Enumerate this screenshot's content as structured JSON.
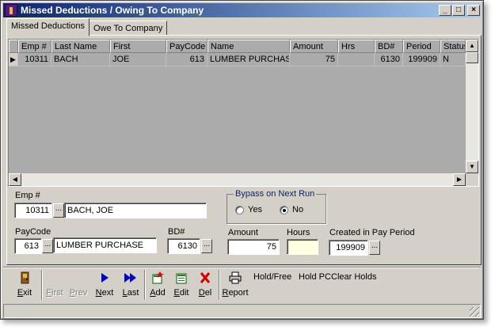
{
  "window": {
    "title": "Missed Deductions / Owing To Company"
  },
  "tabs": [
    "Missed Deductions",
    "Owe To Company"
  ],
  "grid": {
    "columns": [
      "Emp #",
      "Last Name",
      "First",
      "PayCode",
      "Name",
      "Amount",
      "Hrs",
      "BD#",
      "Period",
      "Status"
    ],
    "rows": [
      [
        "10311",
        "BACH",
        "JOE",
        "613",
        "LUMBER PURCHASE",
        "75",
        "",
        "6130",
        "199909",
        "N"
      ]
    ]
  },
  "form": {
    "emp_label": "Emp #",
    "emp_value": "10311",
    "emp_name": "BACH, JOE",
    "bypass_label": "Bypass on Next Run",
    "yes_label": "Yes",
    "no_label": "No",
    "paycode_label": "PayCode",
    "paycode_value": "613",
    "paycode_name": "LUMBER PURCHASE",
    "bd_label": "BD#",
    "bd_value": "6130",
    "amount_label": "Amount",
    "amount_value": "75",
    "hours_label": "Hours",
    "hours_value": "",
    "created_label": "Created in Pay Period",
    "created_value": "199909",
    "ellipsis": "..."
  },
  "toolbar": {
    "exit": "Exit",
    "first": "First",
    "prev": "Prev",
    "next": "Next",
    "last": "Last",
    "add": "Add",
    "edit": "Edit",
    "del": "Del",
    "report": "Report",
    "hold_free": "Hold/Free",
    "hold_pc": "Hold PC",
    "clear_holds": "Clear Holds"
  }
}
